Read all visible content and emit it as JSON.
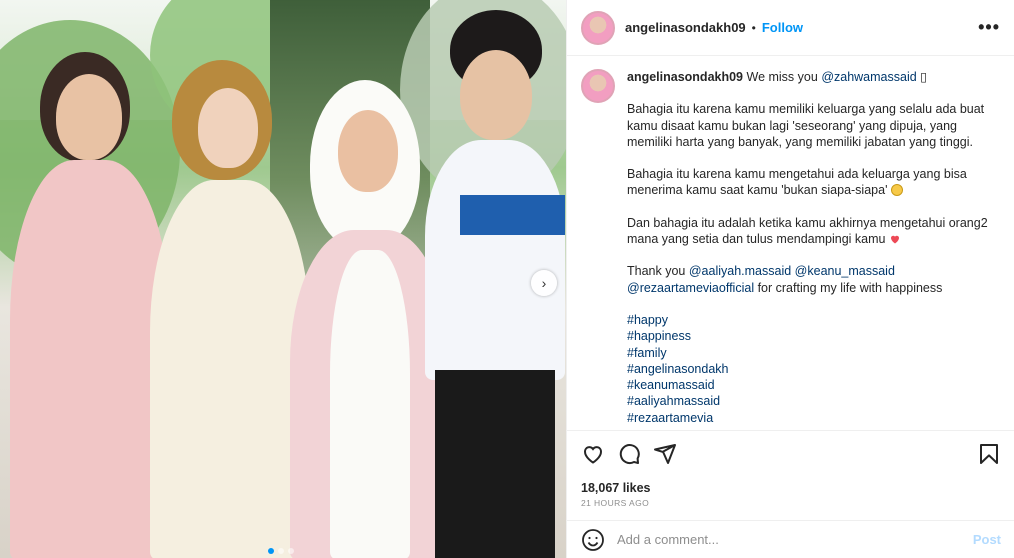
{
  "post": {
    "username": "angelinasondakh09",
    "separator": "•",
    "follow_label": "Follow",
    "more_label": "•••"
  },
  "caption": {
    "username": "angelinasondakh09",
    "intro": "We miss you",
    "mention_zahwa": "@zahwamassaid",
    "intro_glyph": "▯",
    "para1": "Bahagia itu karena kamu memiliki keluarga yang selalu ada buat kamu disaat kamu bukan lagi 'seseorang' yang dipuja, yang memiliki harta yang banyak, yang memiliki jabatan yang tinggi.",
    "para2": "Bahagia itu karena kamu mengetahui ada keluarga yang bisa menerima kamu saat kamu 'bukan siapa-siapa'",
    "para3": "Dan bahagia itu adalah ketika kamu akhirnya mengetahui orang2 mana yang setia dan tulus mendampingi kamu",
    "thanks_prefix": "Thank you",
    "mention_aaliyah": "@aaliyah.massaid",
    "mention_keanu": "@keanu_massaid",
    "mention_reza": "@rezaartameviaofficial",
    "thanks_suffix": "for crafting my life with happiness",
    "hashtags": [
      "#happy",
      "#happiness",
      "#family",
      "#angelinasondakh",
      "#keanumassaid",
      "#aaliyahmassaid",
      "#rezaartamevia"
    ]
  },
  "stats": {
    "likes": "18,067 likes",
    "time": "21 HOURS AGO"
  },
  "comment": {
    "placeholder": "Add a comment...",
    "post_label": "Post"
  },
  "photo": {
    "next_glyph": "›"
  },
  "icons": {
    "like": "heart-icon",
    "comment": "comment-icon",
    "share": "share-icon",
    "save": "bookmark-icon",
    "emoji": "smiley-icon",
    "more": "more-icon"
  },
  "colors": {
    "accent": "#0095f6",
    "link": "#00376b",
    "heart": "#ed4956",
    "muted": "#8e8e8e",
    "post_disabled": "#b3dbff"
  }
}
